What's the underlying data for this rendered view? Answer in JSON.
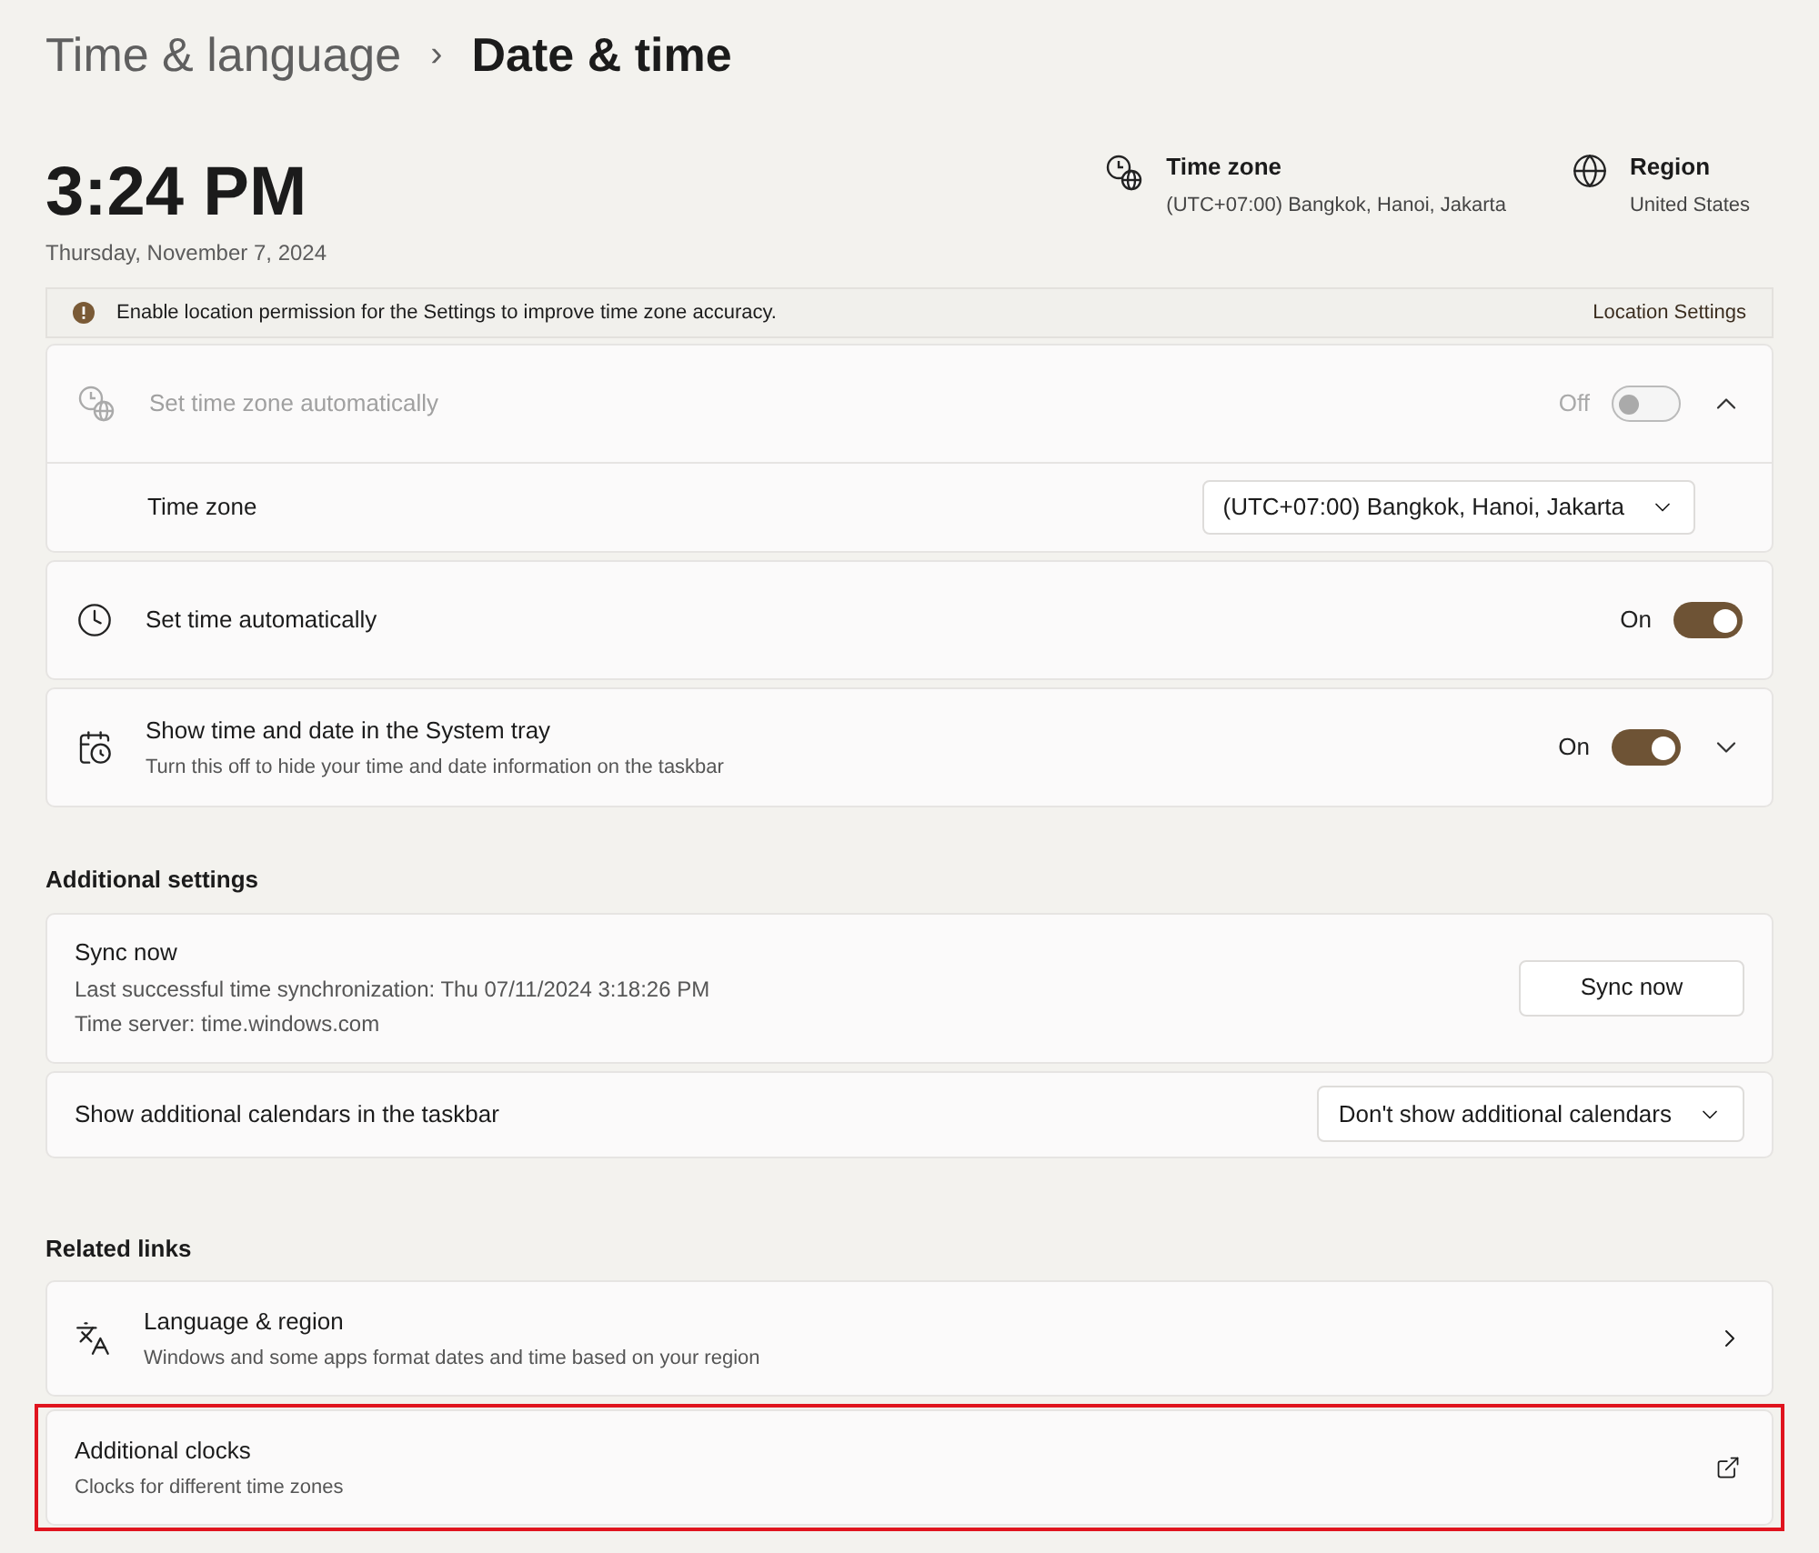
{
  "breadcrumb": {
    "parent": "Time & language",
    "separator": "›",
    "current": "Date & time"
  },
  "clock": {
    "time": "3:24 PM",
    "date": "Thursday, November 7, 2024"
  },
  "summary": [
    {
      "kind": "timezone",
      "label": "Time zone",
      "value": "(UTC+07:00) Bangkok, Hanoi, Jakarta"
    },
    {
      "kind": "region",
      "label": "Region",
      "value": "United States"
    }
  ],
  "notice": {
    "text": "Enable location permission for the Settings to improve time zone accuracy.",
    "link": "Location Settings"
  },
  "settings": [
    {
      "kind": "clock-globe",
      "title": "Set time zone automatically",
      "disabled": true,
      "toggle": {
        "on": false,
        "label": "Off"
      },
      "expanded": true,
      "children": [
        {
          "label": "Time zone",
          "value": "(UTC+07:00) Bangkok, Hanoi, Jakarta"
        }
      ]
    },
    {
      "kind": "clock",
      "title": "Set time automatically",
      "disabled": false,
      "toggle": {
        "on": true,
        "label": "On"
      }
    },
    {
      "kind": "calendar-clock",
      "title": "Show time and date in the System tray",
      "description": "Turn this off to hide your time and date information on the taskbar",
      "disabled": false,
      "toggle": {
        "on": true,
        "label": "On"
      },
      "expanded": false
    }
  ],
  "additional_settings": {
    "heading": "Additional settings",
    "items": [
      {
        "kind": "button",
        "title": "Sync now",
        "lines": [
          "Last successful time synchronization: Thu 07/11/2024 3:18:26 PM",
          "Time server: time.windows.com"
        ],
        "action": "Sync now"
      },
      {
        "kind": "dropdown",
        "title": "Show additional calendars in the taskbar",
        "action": "Don't show additional calendars"
      }
    ]
  },
  "related_links": {
    "heading": "Related links",
    "items": [
      {
        "kind": "internal",
        "title": "Language & region",
        "description": "Windows and some apps format dates and time based on your region",
        "highlighted": false
      },
      {
        "kind": "external",
        "title": "Additional clocks",
        "description": "Clocks for different time zones",
        "highlighted": true
      }
    ]
  }
}
